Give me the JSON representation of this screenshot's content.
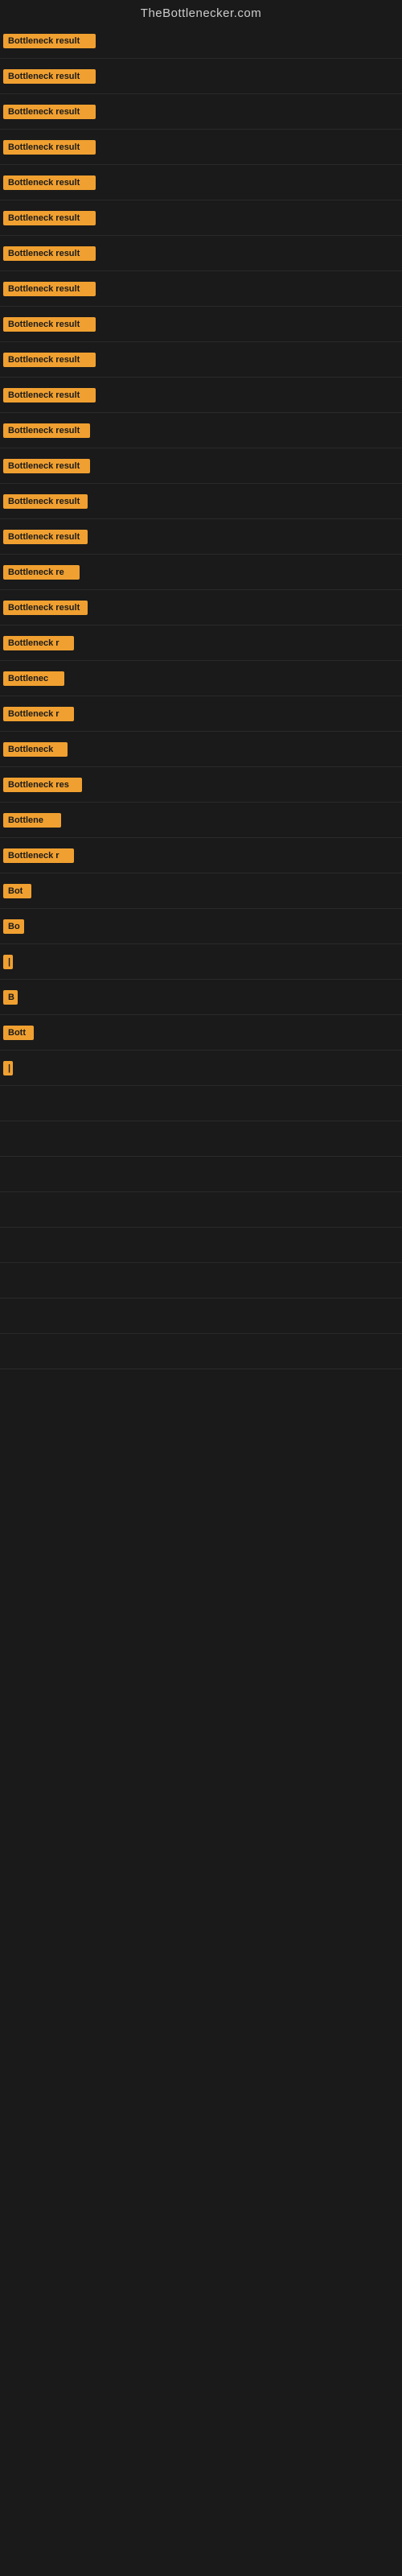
{
  "header": {
    "title": "TheBottlenecker.com"
  },
  "rows": [
    {
      "label": "Bottleneck result",
      "width": 115
    },
    {
      "label": "Bottleneck result",
      "width": 115
    },
    {
      "label": "Bottleneck result",
      "width": 115
    },
    {
      "label": "Bottleneck result",
      "width": 115
    },
    {
      "label": "Bottleneck result",
      "width": 115
    },
    {
      "label": "Bottleneck result",
      "width": 115
    },
    {
      "label": "Bottleneck result",
      "width": 115
    },
    {
      "label": "Bottleneck result",
      "width": 115
    },
    {
      "label": "Bottleneck result",
      "width": 115
    },
    {
      "label": "Bottleneck result",
      "width": 115
    },
    {
      "label": "Bottleneck result",
      "width": 115
    },
    {
      "label": "Bottleneck result",
      "width": 108
    },
    {
      "label": "Bottleneck result",
      "width": 108
    },
    {
      "label": "Bottleneck result",
      "width": 105
    },
    {
      "label": "Bottleneck result",
      "width": 105
    },
    {
      "label": "Bottleneck re",
      "width": 95
    },
    {
      "label": "Bottleneck result",
      "width": 105
    },
    {
      "label": "Bottleneck r",
      "width": 88
    },
    {
      "label": "Bottlenec",
      "width": 76
    },
    {
      "label": "Bottleneck r",
      "width": 88
    },
    {
      "label": "Bottleneck",
      "width": 80
    },
    {
      "label": "Bottleneck res",
      "width": 98
    },
    {
      "label": "Bottlene",
      "width": 72
    },
    {
      "label": "Bottleneck r",
      "width": 88
    },
    {
      "label": "Bot",
      "width": 35
    },
    {
      "label": "Bo",
      "width": 26
    },
    {
      "label": "|",
      "width": 10
    },
    {
      "label": "B",
      "width": 18
    },
    {
      "label": "Bott",
      "width": 38
    },
    {
      "label": "|",
      "width": 10
    },
    {
      "label": "",
      "width": 0
    },
    {
      "label": "",
      "width": 0
    },
    {
      "label": "",
      "width": 0
    },
    {
      "label": "",
      "width": 0
    },
    {
      "label": "",
      "width": 0
    },
    {
      "label": "",
      "width": 0
    },
    {
      "label": "",
      "width": 0
    },
    {
      "label": "",
      "width": 0
    }
  ]
}
